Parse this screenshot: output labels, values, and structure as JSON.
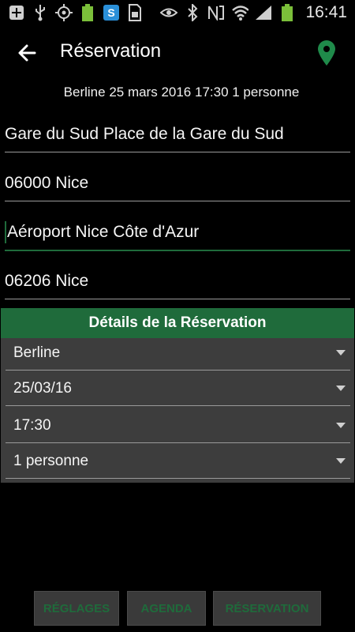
{
  "status": {
    "time": "16:41",
    "icons": [
      "plus-box-icon",
      "usb-icon",
      "location-crosshair-icon",
      "battery-100-icon",
      "skype-icon",
      "sim-icon",
      "eye-icon",
      "bluetooth-icon",
      "nfc-icon",
      "wifi-icon",
      "signal-icon",
      "battery-icon"
    ]
  },
  "appbar": {
    "title": "Réservation"
  },
  "summary": "Berline 25 mars 2016 17:30 1 personne",
  "fields": {
    "from_address": "Gare du Sud Place de la Gare du Sud",
    "from_city": "06000 Nice",
    "to_address": "Aéroport Nice Côte d'Azur",
    "to_city": "06206 Nice"
  },
  "details": {
    "header": "Détails de la Réservation",
    "vehicle": "Berline",
    "date": "25/03/16",
    "time": "17:30",
    "passengers": "1 personne"
  },
  "buttons": {
    "settings": "RÉGLAGES",
    "agenda": "AGENDA",
    "reservation": "RÉSERVATION"
  },
  "colors": {
    "accent": "#1f6b3b",
    "panel": "#3d3d3d",
    "button": "#3a3a3a"
  }
}
